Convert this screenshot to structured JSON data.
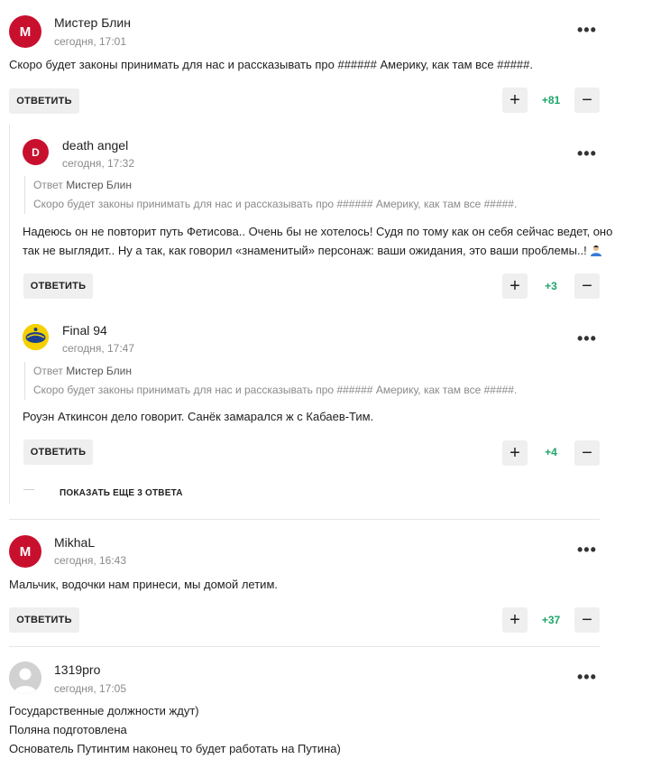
{
  "colors": {
    "accent": "#c8102e",
    "score": "#1fa56b",
    "button_bg": "#efefef"
  },
  "comments": [
    {
      "initial": "М",
      "author": "Мистер Блин",
      "time": "сегодня, 17:01",
      "text": "Скоро будет законы принимать для нас и рассказывать про ###### Америку, как там все #####.",
      "reply_label": "ОТВЕТИТЬ",
      "score": "+81",
      "replies": [
        {
          "initial": "D",
          "author": "death angel",
          "time": "сегодня, 17:32",
          "quote_prefix": "Ответ",
          "quote_author": "Мистер Блин",
          "quote_text": "Скоро будет законы принимать для нас и рассказывать про ###### Америку, как там все #####.",
          "text_line1": "Надеюсь он не повторит путь Фетисова.. Очень бы не хотелось! Судя по тому как он себя сейчас ведет, оно",
          "text_line2": "так не выглядит.. Ну а так, как говорил «знаменитый» персонаж: ваши ожидания, это ваши проблемы..!",
          "reply_label": "ОТВЕТИТЬ",
          "score": "+3"
        },
        {
          "author": "Final 94",
          "time": "сегодня, 17:47",
          "quote_prefix": "Ответ",
          "quote_author": "Мистер Блин",
          "quote_text": "Скоро будет законы принимать для нас и рассказывать про ###### Америку, как там все #####.",
          "text": "Роуэн Аткинсон дело говорит. Санёк замарался ж с Кабаев-Тим.",
          "reply_label": "ОТВЕТИТЬ",
          "score": "+4"
        }
      ],
      "show_more": "ПОКАЗАТЬ ЕЩЕ 3 ОТВЕТА"
    },
    {
      "initial": "M",
      "author": "MikhaL",
      "time": "сегодня, 16:43",
      "text": "Мальчик, водочки нам принеси, мы домой летим.",
      "reply_label": "ОТВЕТИТЬ",
      "score": "+37"
    },
    {
      "author": "1319pro",
      "time": "сегодня, 17:05",
      "lines": [
        "Государственные должности ждут)",
        "Поляна подготовлена",
        "Основатель Путинтим наконец то будет работать на Путина)"
      ]
    }
  ],
  "icons": {
    "more": "more-dots-icon",
    "plus": "plus-icon",
    "minus": "minus-icon"
  }
}
